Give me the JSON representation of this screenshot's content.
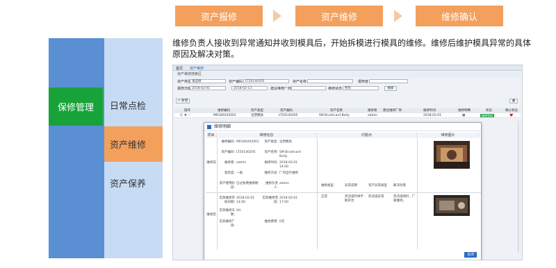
{
  "steps": [
    "资产报修",
    "资产维修",
    "维修确认"
  ],
  "module": "保修管理",
  "subitems": [
    "日常点检",
    "资产维修",
    "资产保养"
  ],
  "description": "维修负责人接收到异常通知并收到模具后，开始拆模进行模具的维修。维修后维护模具异常的具体原因及解决对策。",
  "app": {
    "nav": [
      "首页",
      "资产维修"
    ],
    "panel_title": "资产维修搜索区",
    "search": {
      "type_label": "资产类型",
      "type_value": "请选择",
      "code_label": "资产编码",
      "code_value": "LT20140205",
      "name_label": "资产名称",
      "reporter_label": "报修者",
      "date_label": "报修日期",
      "date_from": "2018-02-01",
      "date_to": "2018-02-13",
      "factory_label": "建议维修厂商",
      "status_label": "维修状态",
      "status_value": "所有",
      "search_button": "搜索"
    },
    "new_button": "+ 新增",
    "columns": [
      "操作",
      "维修编码",
      "资产类型",
      "资产编码",
      "资产名称",
      "报修者",
      "建议维修厂商",
      "报修时间",
      "维修明细",
      "状态",
      "确认状态"
    ],
    "row": {
      "code": "MR180202001",
      "type": "注塑模具",
      "asset": "LT20140205",
      "name": "SM Brushcard Body",
      "reporter": "admin",
      "vendor": "",
      "time": "2018-02-01",
      "status": "维修完成"
    },
    "modal": {
      "title": "维修明细",
      "headers": [
        "项目",
        "维修信息",
        "问题点",
        "维修图片"
      ],
      "section_before": "维修前",
      "section_after": "维修后",
      "info": [
        [
          "维修编码:",
          "MR180202001",
          "资产类型:",
          "注塑模具"
        ],
        [
          "资产编码:",
          "LT20140205",
          "资产名称:",
          "SM Brushcard Body"
        ],
        [
          "报修者:",
          "admin",
          "报修时间:",
          "2018-02-01 14:00"
        ],
        [
          "紧急度:",
          "一般",
          "维修方式:",
          "厂内自行维修"
        ],
        [
          "资产使用阶段:",
          "已过免费维修期",
          "维修负责人:",
          "admin"
        ]
      ],
      "after_info": [
        [
          "实际维修开始日期:",
          "2018-02-01 14:00",
          "实际维修完成:",
          "2018-02-01 17:00"
        ],
        [
          "实际维修天数:",
          "0H",
          "",
          ""
        ],
        [
          "实际维修厂商:",
          "",
          "维修费用:",
          "0元"
        ]
      ],
      "problem_headers": [
        "维修类型",
        "异常说明",
        "资产异常类型",
        "解决对策"
      ],
      "problem_row": [
        "正常",
        "热流道针阀不能开合",
        "热流道异常",
        "热流道阀针，厂家维修。"
      ],
      "close_button": "关闭"
    }
  }
}
